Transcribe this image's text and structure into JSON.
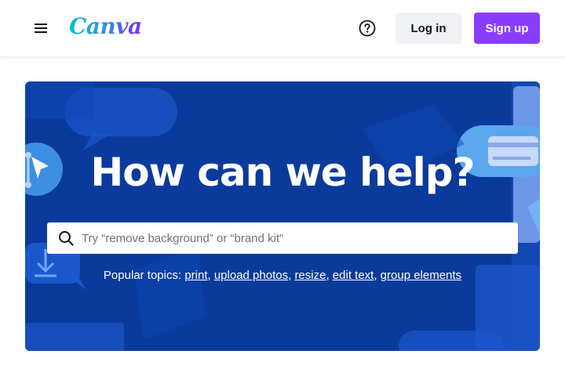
{
  "header": {
    "logo_text": "Canva",
    "menu_icon": "hamburger-menu-icon",
    "help_icon": "help-circle-icon",
    "login_label": "Log in",
    "signup_label": "Sign up"
  },
  "hero": {
    "title": "How can we help?",
    "search": {
      "placeholder": "Try “remove background” or “brand kit”",
      "value": "",
      "icon": "search-icon"
    },
    "popular_topics": {
      "label": "Popular topics:",
      "separator": ",",
      "links": [
        "print",
        "upload photos",
        "resize",
        "edit text",
        "group elements"
      ]
    }
  },
  "colors": {
    "brand_purple": "#8b3dff",
    "hero_blue": "#0a3b9c",
    "login_bg": "#f0f1f5"
  }
}
